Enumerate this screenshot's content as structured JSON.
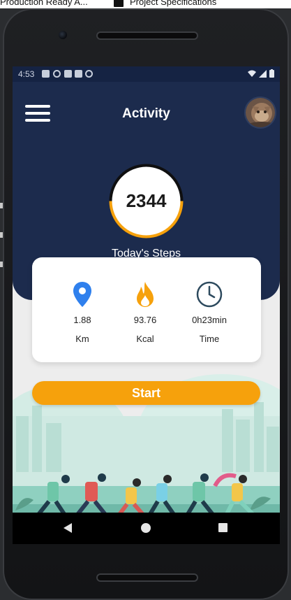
{
  "host": {
    "tab1": "Production Ready A...",
    "tab2": "Project Specifications"
  },
  "status_bar": {
    "time": "4:53",
    "icons": [
      "image-icon",
      "google-icon",
      "sim-icon",
      "sync-icon",
      "wifi-icon",
      "signal-icon",
      "battery-icon"
    ]
  },
  "header": {
    "title": "Activity",
    "menu_icon": "hamburger-menu-icon",
    "avatar_icon": "cat-avatar"
  },
  "steps": {
    "value": "2344",
    "label": "Today's Steps",
    "ring_color": "#f6a10c"
  },
  "stats": [
    {
      "icon": "location-pin-icon",
      "value": "1.88",
      "unit": "Km",
      "color": "#2f80ed"
    },
    {
      "icon": "flame-icon",
      "value": "93.76",
      "unit": "Kcal",
      "color": "#f6a10c"
    },
    {
      "icon": "clock-icon",
      "value": "0h23min",
      "unit": "Time",
      "color": "#2d4a5e"
    }
  ],
  "start_button": {
    "label": "Start",
    "color": "#f6a10c"
  },
  "colors": {
    "header_bg": "#1c2b4d",
    "status_bg": "#152343",
    "screen_bg": "#ededed"
  },
  "nav": {
    "back": "back-triangle-icon",
    "home": "home-circle-icon",
    "recent": "recent-square-icon"
  }
}
